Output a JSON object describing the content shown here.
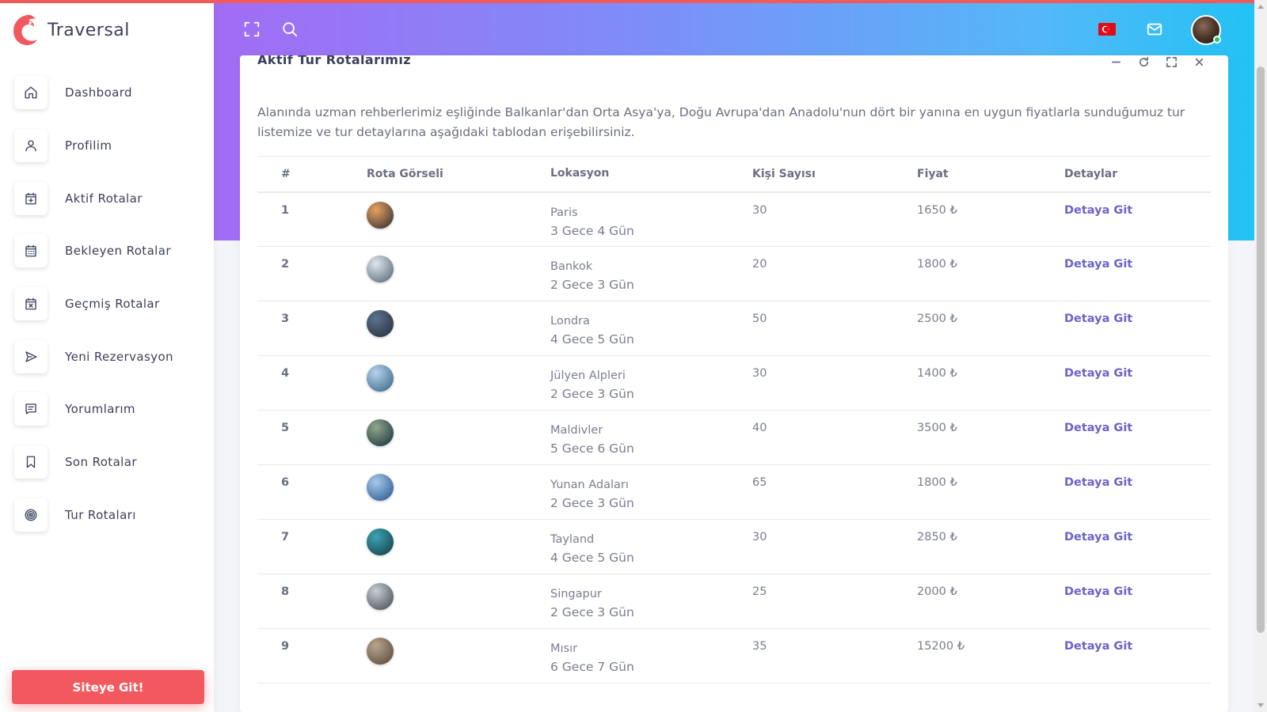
{
  "app": {
    "name": "Traversal"
  },
  "sidebar": {
    "items": [
      {
        "label": "Dashboard",
        "icon": "home-icon"
      },
      {
        "label": "Profilim",
        "icon": "user-icon"
      },
      {
        "label": "Aktif Rotalar",
        "icon": "calendar-plus-icon"
      },
      {
        "label": "Bekleyen Rotalar",
        "icon": "calendar-icon"
      },
      {
        "label": "Geçmiş Rotalar",
        "icon": "calendar-x-icon"
      },
      {
        "label": "Yeni Rezervasyon",
        "icon": "send-icon"
      },
      {
        "label": "Yorumlarım",
        "icon": "message-icon"
      },
      {
        "label": "Son Rotalar",
        "icon": "bookmark-icon"
      },
      {
        "label": "Tur Rotaları",
        "icon": "target-icon"
      }
    ],
    "cta_label": "Siteye Git!"
  },
  "colors": {
    "accent": "#f2595f",
    "link": "#6c63c9",
    "gradient_start": "#a26cf4",
    "gradient_end": "#22c2f4"
  },
  "card": {
    "title": "Aktif Tur Rotalarımız",
    "description": "Alanında uzman rehberlerimiz eşliğinde Balkanlar'dan Orta Asya'ya, Doğu Avrupa'dan Anadolu'nun dört bir yanına en uygun fiyatlarla sunduğumuz tur listemize ve tur detaylarına aşağıdaki tablodan erişebilirsiniz.",
    "table": {
      "headers": [
        "#",
        "Rota Görseli",
        "Lokasyon",
        "Kişi Sayısı",
        "Fiyat",
        "Detaylar"
      ],
      "rows": [
        {
          "num": "1",
          "location": "Paris",
          "duration": "3 Gece 4 Gün",
          "people": "30",
          "price": "1650 ₺",
          "detail": "Detaya Git",
          "thumb_colors": [
            "#e9a25e",
            "#3a3436"
          ]
        },
        {
          "num": "2",
          "location": "Bankok",
          "duration": "2 Gece 3 Gün",
          "people": "20",
          "price": "1800 ₺",
          "detail": "Detaya Git",
          "thumb_colors": [
            "#dfe6ee",
            "#5d6d7c"
          ]
        },
        {
          "num": "3",
          "location": "Londra",
          "duration": "4 Gece 5 Gün",
          "people": "50",
          "price": "2500 ₺",
          "detail": "Detaya Git",
          "thumb_colors": [
            "#5c7490",
            "#27323f"
          ]
        },
        {
          "num": "4",
          "location": "Jülyen Alpleri",
          "duration": "2 Gece 3 Gün",
          "people": "30",
          "price": "1400 ₺",
          "detail": "Detaya Git",
          "thumb_colors": [
            "#b9d2ec",
            "#3c6d8c"
          ]
        },
        {
          "num": "5",
          "location": "Maldivler",
          "duration": "5 Gece 6 Gün",
          "people": "40",
          "price": "3500 ₺",
          "detail": "Detaya Git",
          "thumb_colors": [
            "#8fa88a",
            "#1f3a44"
          ]
        },
        {
          "num": "6",
          "location": "Yunan Adaları",
          "duration": "2 Gece 3 Gün",
          "people": "65",
          "price": "1800 ₺",
          "detail": "Detaya Git",
          "thumb_colors": [
            "#a8c9ea",
            "#2e5f93"
          ]
        },
        {
          "num": "7",
          "location": "Tayland",
          "duration": "4 Gece 5 Gün",
          "people": "30",
          "price": "2850 ₺",
          "detail": "Detaya Git",
          "thumb_colors": [
            "#3aa5b3",
            "#17424e"
          ]
        },
        {
          "num": "8",
          "location": "Singapur",
          "duration": "2 Gece 3 Gün",
          "people": "25",
          "price": "2000 ₺",
          "detail": "Detaya Git",
          "thumb_colors": [
            "#c7cfd6",
            "#4b5258"
          ]
        },
        {
          "num": "9",
          "location": "Mısır",
          "duration": "6 Gece 7 Gün",
          "people": "35",
          "price": "15200 ₺",
          "detail": "Detaya Git",
          "thumb_colors": [
            "#b7a58d",
            "#5d4d3d"
          ]
        }
      ]
    }
  }
}
